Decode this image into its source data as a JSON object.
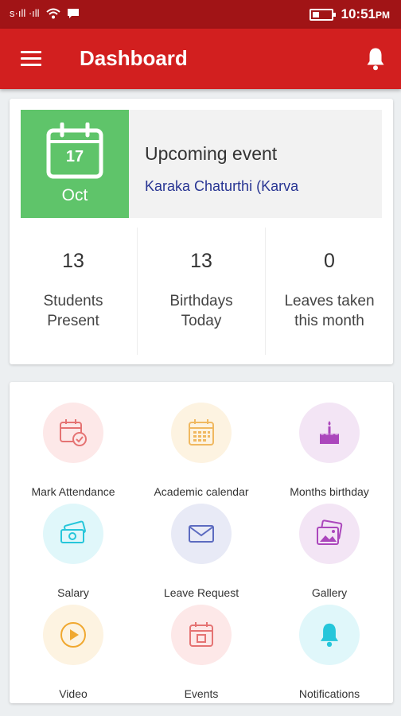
{
  "status_bar": {
    "signal_text": "s·ıll ·ıll",
    "time": "10:51",
    "time_suffix": "PM",
    "battery_level": 0.35
  },
  "app_bar": {
    "title": "Dashboard",
    "menu_icon": "hamburger-menu-icon",
    "notification_icon": "bell-icon"
  },
  "event": {
    "day": "17",
    "month": "Oct",
    "heading": "Upcoming event",
    "name": "Karaka Chaturthi (Karva",
    "tile_color": "#5fc46a",
    "icon": "calendar-icon"
  },
  "stats": [
    {
      "value": "13",
      "label_line1": "Students",
      "label_line2": "Present"
    },
    {
      "value": "13",
      "label_line1": "Birthdays",
      "label_line2": "Today"
    },
    {
      "value": "0",
      "label_line1": "Leaves taken",
      "label_line2": "this month"
    }
  ],
  "menu": [
    {
      "label": "Mark Attendance",
      "icon": "attendance-calendar-icon",
      "bg": "#fde8e8",
      "color": "#e57373"
    },
    {
      "label": "Academic calendar",
      "icon": "calendar-grid-icon",
      "bg": "#fdf3e1",
      "color": "#f0b860"
    },
    {
      "label": "Months birthday",
      "icon": "birthday-cake-icon",
      "bg": "#f3e5f5",
      "color": "#ab47bc"
    },
    {
      "label": "Salary",
      "icon": "money-icon",
      "bg": "#e0f7fa",
      "color": "#26c6da"
    },
    {
      "label": "Leave Request",
      "icon": "envelope-icon",
      "bg": "#e8eaf6",
      "color": "#5c6bc0"
    },
    {
      "label": "Gallery",
      "icon": "gallery-icon",
      "bg": "#f3e5f5",
      "color": "#ab47bc"
    },
    {
      "label": "Video",
      "icon": "play-icon",
      "bg": "#fdf3e1",
      "color": "#f0a830"
    },
    {
      "label": "Events",
      "icon": "event-calendar-icon",
      "bg": "#fde8e8",
      "color": "#e57373"
    },
    {
      "label": "Notifications",
      "icon": "bell-icon",
      "bg": "#e0f7fa",
      "color": "#26c6da"
    }
  ],
  "colors": {
    "status_bar": "#a11416",
    "app_bar": "#d21f1f",
    "link_text": "#283593"
  }
}
